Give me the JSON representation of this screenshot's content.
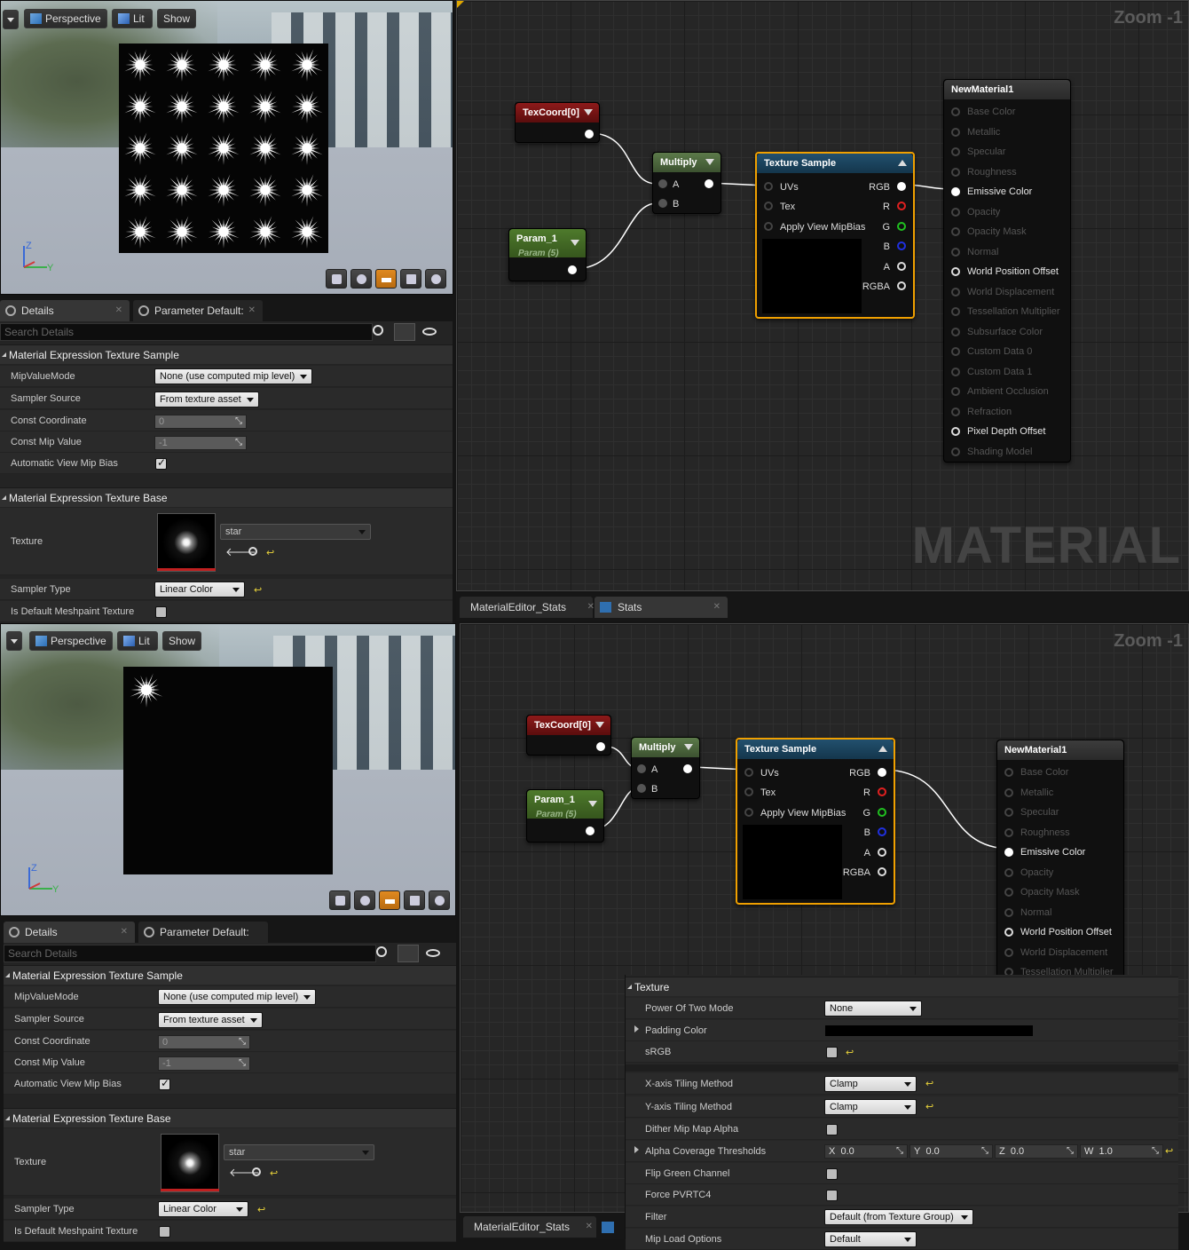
{
  "viewport": {
    "perspective": "Perspective",
    "lit": "Lit",
    "show": "Show",
    "axis_z": "Z",
    "axis_y": "Y"
  },
  "details": {
    "tab_details": "Details",
    "tab_param": "Parameter Default:",
    "search_placeholder": "Search Details",
    "section_sample": "Material Expression Texture Sample",
    "mip_label": "MipValueMode",
    "mip_value": "None (use computed mip level)",
    "sampler_source_label": "Sampler Source",
    "sampler_source_value": "From texture asset",
    "const_coord_label": "Const Coordinate",
    "const_coord_value": "0",
    "const_mip_label": "Const Mip Value",
    "const_mip_value": "-1",
    "auto_mip_label": "Automatic View Mip Bias",
    "section_base": "Material Expression Texture Base",
    "texture_label": "Texture",
    "texture_value": "star",
    "sampler_type_label": "Sampler Type",
    "sampler_type_value": "Linear Color",
    "meshpaint_label": "Is Default Meshpaint Texture"
  },
  "graph": {
    "zoom": "Zoom -1",
    "watermark": "MATERIAL",
    "texcoord": "TexCoord[0]",
    "multiply": "Multiply",
    "pin_a": "A",
    "pin_b": "B",
    "param": "Param_1",
    "param_sub": "Param (5)",
    "texsample": "Texture Sample",
    "in_uvs": "UVs",
    "in_tex": "Tex",
    "in_mip": "Apply View MipBias",
    "out_rgb": "RGB",
    "out_r": "R",
    "out_g": "G",
    "out_b": "B",
    "out_a": "A",
    "out_rgba": "RGBA",
    "material": "NewMaterial1",
    "mat_pins": [
      "Base Color",
      "Metallic",
      "Specular",
      "Roughness",
      "Emissive Color",
      "Opacity",
      "Opacity Mask",
      "Normal",
      "World Position Offset",
      "World Displacement",
      "Tessellation Multiplier",
      "Subsurface Color",
      "Custom Data 0",
      "Custom Data 1",
      "Ambient Occlusion",
      "Refraction",
      "Pixel Depth Offset",
      "Shading Model"
    ]
  },
  "bottom_tabs": {
    "stats_tab": "MaterialEditor_Stats",
    "stats2_tab": "Stats"
  },
  "texture_props": {
    "section": "Texture",
    "pot_label": "Power Of Two Mode",
    "pot_value": "None",
    "padding_label": "Padding Color",
    "srgb_label": "sRGB",
    "xtile_label": "X-axis Tiling Method",
    "xtile_value": "Clamp",
    "ytile_label": "Y-axis Tiling Method",
    "ytile_value": "Clamp",
    "dither_label": "Dither Mip Map Alpha",
    "alpha_cov_label": "Alpha Coverage Thresholds",
    "x_label": "X",
    "x_value": "0.0",
    "y_label": "Y",
    "y_value": "0.0",
    "z_label": "Z",
    "z_value": "0.0",
    "w_label": "W",
    "w_value": "1.0",
    "flip_label": "Flip Green Channel",
    "pvrtc_label": "Force PVRTC4",
    "filter_label": "Filter",
    "filter_value": "Default (from Texture Group)",
    "mipload_label": "Mip Load Options",
    "mipload_value": "Default"
  },
  "colors": {
    "selected_outline": "#f0a000",
    "texcoord_header": "#8e1a1a",
    "param_header": "#4e7a2c",
    "texsample_header": "#22506e"
  }
}
